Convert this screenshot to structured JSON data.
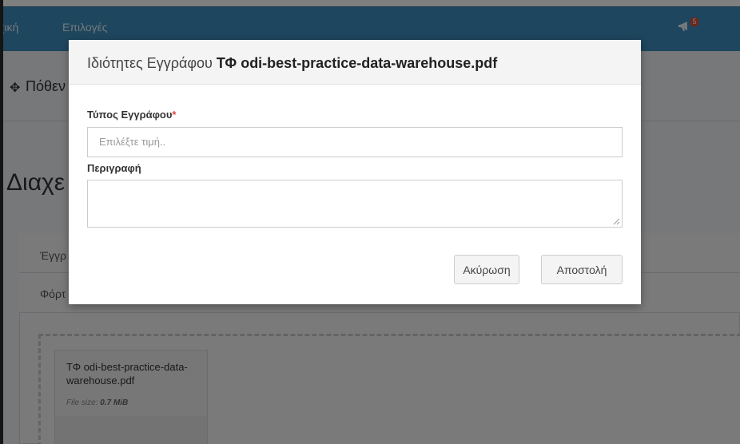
{
  "navbar": {
    "home_label": "χική",
    "options_label": "Επιλογές",
    "notification_count": "5"
  },
  "breadcrumb": {
    "text": "Πόθεν"
  },
  "page": {
    "heading": "Διαχε"
  },
  "panel": {
    "tab1_label": "Έγγρ",
    "tab2_label": "Φόρτ"
  },
  "file_card": {
    "name": "ΤΦ odi-best-practice-data-warehouse.pdf",
    "size_label": "File size:",
    "size_value": "0.7 MiB"
  },
  "modal": {
    "title_prefix": "Ιδιότητες Εγγράφου",
    "title_filename": "ΤΦ odi-best-practice-data-warehouse.pdf",
    "doc_type_label": "Τύπος Εγγράφου",
    "required_mark": "*",
    "doc_type_placeholder": "Επιλέξτε τιμή..",
    "description_label": "Περιγραφή",
    "description_value": "",
    "cancel_label": "Ακύρωση",
    "submit_label": "Αποστολή"
  }
}
